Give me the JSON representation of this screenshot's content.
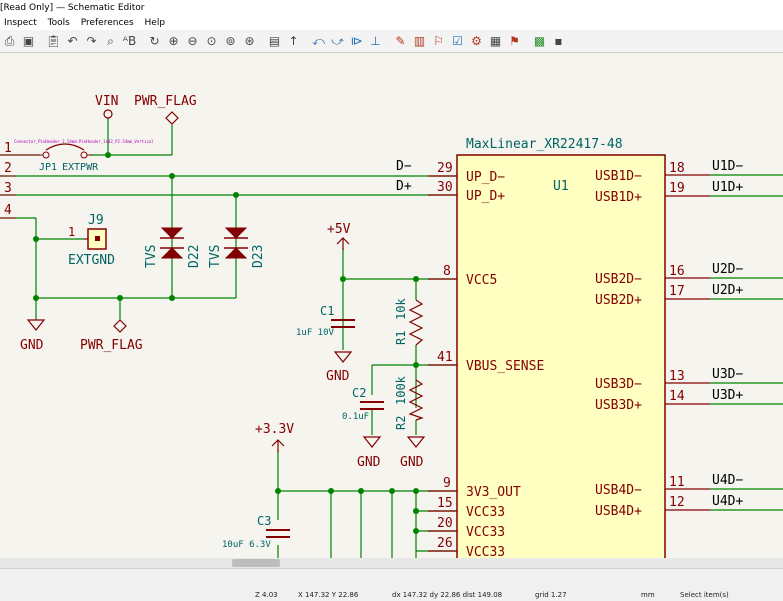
{
  "window": {
    "title": "[Read Only] — Schematic Editor"
  },
  "menu": {
    "items": [
      "Inspect",
      "Tools",
      "Preferences",
      "Help"
    ]
  },
  "schematic": {
    "wire_numbers": [
      "1",
      "2",
      "3",
      "4"
    ],
    "vin": "VIN",
    "pwr_flag_top": "PWR_FLAG",
    "connector_tiny": "Connector_PinHeader_2.54mm:PinHeader_1x02_P2.54mm_Vertical",
    "jp1": "JP1",
    "extpwr": "EXTPWR",
    "j9": "J9",
    "j9_pin": "1",
    "extgnd": "EXTGND",
    "tvs": "TVS",
    "d22": "D22",
    "d23": "D23",
    "gnd": "GND",
    "pwr_flag_bottom": "PWR_FLAG",
    "net_dm": "D−",
    "net_dp": "D+",
    "u1_value": "MaxLinear_XR22417-48",
    "u1_ref": "U1",
    "pins_left": [
      {
        "num": "29",
        "name": "UP_D−"
      },
      {
        "num": "30",
        "name": "UP_D+"
      },
      {
        "num": "8",
        "name": "VCC5"
      },
      {
        "num": "41",
        "name": "VBUS_SENSE"
      },
      {
        "num": "9",
        "name": "3V3_OUT"
      },
      {
        "num": "15",
        "name": "VCC33"
      },
      {
        "num": "20",
        "name": "VCC33"
      },
      {
        "num": "26",
        "name": "VCC33"
      }
    ],
    "pins_right": [
      {
        "num": "18",
        "name": "USB1D−",
        "net": "U1D−"
      },
      {
        "num": "19",
        "name": "USB1D+",
        "net": "U1D+"
      },
      {
        "num": "16",
        "name": "USB2D−",
        "net": "U2D−"
      },
      {
        "num": "17",
        "name": "USB2D+",
        "net": "U2D+"
      },
      {
        "num": "13",
        "name": "USB3D−",
        "net": "U3D−"
      },
      {
        "num": "14",
        "name": "USB3D+",
        "net": "U3D+"
      },
      {
        "num": "11",
        "name": "USB4D−",
        "net": "U4D−"
      },
      {
        "num": "12",
        "name": "USB4D+",
        "net": "U4D+"
      }
    ],
    "plus5v": "+5V",
    "plus3v3": "+3.3V",
    "c1": "C1",
    "c1_value": "1uF 10V",
    "c2": "C2",
    "c2_value": "0.1uF",
    "c3": "C3",
    "c3_value": "10uF 6.3V",
    "r1": "R1",
    "r1_value": "10k",
    "r2": "R2",
    "r2_value": "100k"
  },
  "status": {
    "zoom": "Z 4.03",
    "xy": "X 147.32  Y 22.86",
    "delta": "dx 147.32  dy 22.86  dist 149.08",
    "grid": "grid 1.27",
    "units": "mm",
    "mode": "Select item(s)"
  },
  "colors": {
    "wire": "#008400",
    "symbol": "#840000",
    "body_fill": "#ffffc2",
    "pin_text": "#840000",
    "net_text": "#000000",
    "junction": "#008400",
    "power": "#840000"
  }
}
